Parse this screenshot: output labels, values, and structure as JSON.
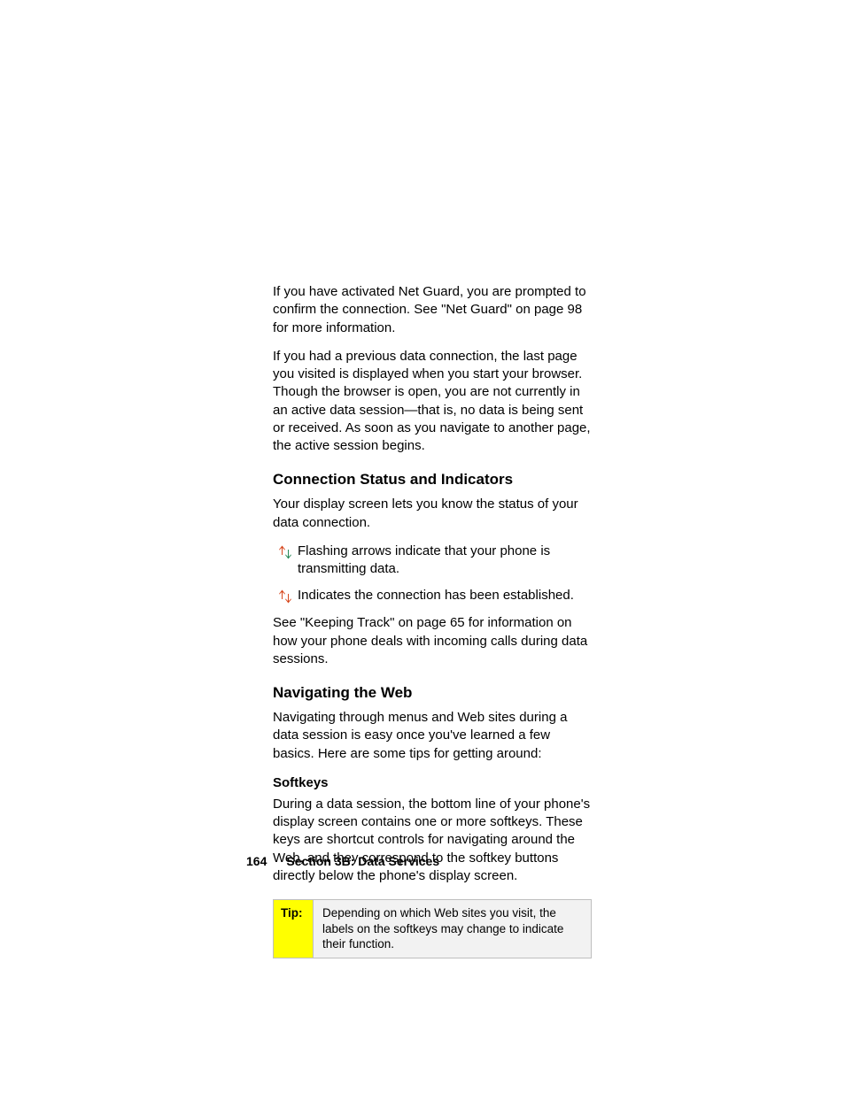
{
  "intro": {
    "p1": "If you have activated Net Guard, you are prompted to confirm the connection. See \"Net Guard\" on page 98 for more information.",
    "p2": "If you had a previous data connection, the last page you visited is displayed when you start your browser. Though the browser is open, you are not currently in an active data session—that is, no data is being sent or received. As soon as you navigate to another page, the active session begins."
  },
  "connection": {
    "heading": "Connection Status and Indicators",
    "p1": "Your display screen lets you know the status of your data connection.",
    "icon1_text": "Flashing arrows indicate that your phone is transmitting data.",
    "icon2_text": "Indicates the connection has been established.",
    "p2": "See \"Keeping Track\" on page 65 for information on how your phone deals with incoming calls during data sessions."
  },
  "navigating": {
    "heading": "Navigating the Web",
    "p1": "Navigating through menus and Web sites during a data session is easy once you've learned a few basics. Here are some tips for getting around:"
  },
  "softkeys": {
    "heading": "Softkeys",
    "p1": "During a data session, the bottom line of your phone's display screen contains one or more softkeys. These keys are shortcut controls for navigating around the Web, and they correspond to the softkey buttons directly below the phone's display screen."
  },
  "tip": {
    "label": "Tip:",
    "body": "Depending on which Web sites you visit, the labels on the softkeys may change to indicate their function."
  },
  "footer": {
    "page": "164",
    "section": "Section 3B: Data Services"
  }
}
